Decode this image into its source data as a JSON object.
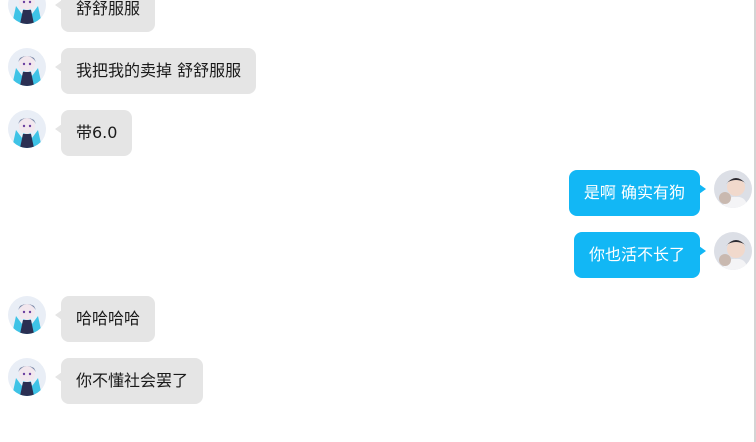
{
  "chat": {
    "messages": [
      {
        "side": "left",
        "text": "舒舒服服",
        "avatar": "anime-character-avatar"
      },
      {
        "side": "left",
        "text": "我把我的卖掉 舒舒服服",
        "avatar": "anime-character-avatar"
      },
      {
        "side": "left",
        "text": "带6.0",
        "avatar": "anime-character-avatar"
      },
      {
        "side": "right",
        "text": "是啊 确实有狗",
        "avatar": "user-photo-avatar"
      },
      {
        "side": "right",
        "text": "你也活不长了",
        "avatar": "user-photo-avatar"
      },
      {
        "side": "left",
        "text": "哈哈哈哈",
        "avatar": "anime-character-avatar"
      },
      {
        "side": "left",
        "text": "你不懂社会罢了",
        "avatar": "anime-character-avatar"
      }
    ]
  },
  "colors": {
    "incoming_bubble": "#e5e5e5",
    "outgoing_bubble": "#12b7f5",
    "background": "#ffffff"
  }
}
